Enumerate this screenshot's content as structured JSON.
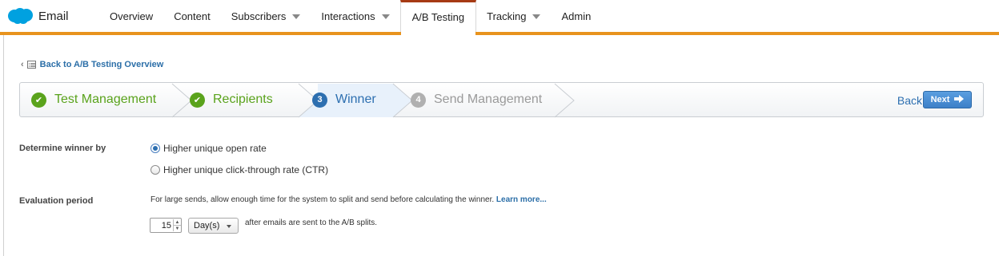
{
  "app": {
    "name": "Email",
    "logo_icon": "salesforce-cloud-icon",
    "brand_color": "#00a1e0"
  },
  "nav": {
    "accent": "#e8931d",
    "items": [
      {
        "label": "Overview",
        "dropdown": false,
        "active": false
      },
      {
        "label": "Content",
        "dropdown": false,
        "active": false
      },
      {
        "label": "Subscribers",
        "dropdown": true,
        "active": false
      },
      {
        "label": "Interactions",
        "dropdown": true,
        "active": false
      },
      {
        "label": "A/B Testing",
        "dropdown": false,
        "active": true
      },
      {
        "label": "Tracking",
        "dropdown": true,
        "active": false
      },
      {
        "label": "Admin",
        "dropdown": false,
        "active": false
      }
    ]
  },
  "back_link": {
    "label": "Back to A/B Testing Overview"
  },
  "wizard": {
    "steps": [
      {
        "badge": "✔",
        "label": "Test Management",
        "state": "done"
      },
      {
        "badge": "✔",
        "label": "Recipients",
        "state": "done"
      },
      {
        "badge": "3",
        "label": "Winner",
        "state": "current"
      },
      {
        "badge": "4",
        "label": "Send Management",
        "state": "future"
      }
    ],
    "back_label": "Back",
    "next_label": "Next",
    "colors": {
      "done": "#5aa31c",
      "current": "#2d6fb0",
      "future": "#9a9a9a"
    }
  },
  "form": {
    "determine": {
      "label": "Determine winner by",
      "options": [
        {
          "label": "Higher unique open rate",
          "selected": true
        },
        {
          "label": "Higher unique click-through rate (CTR)",
          "selected": false
        }
      ]
    },
    "evaluation": {
      "label": "Evaluation period",
      "help_text": "For large sends, allow enough time for the system to split and send before calculating the winner.",
      "learn_more": "Learn more...",
      "value": "15",
      "unit": "Day(s)",
      "after_text": "after emails are sent to the A/B splits."
    }
  }
}
